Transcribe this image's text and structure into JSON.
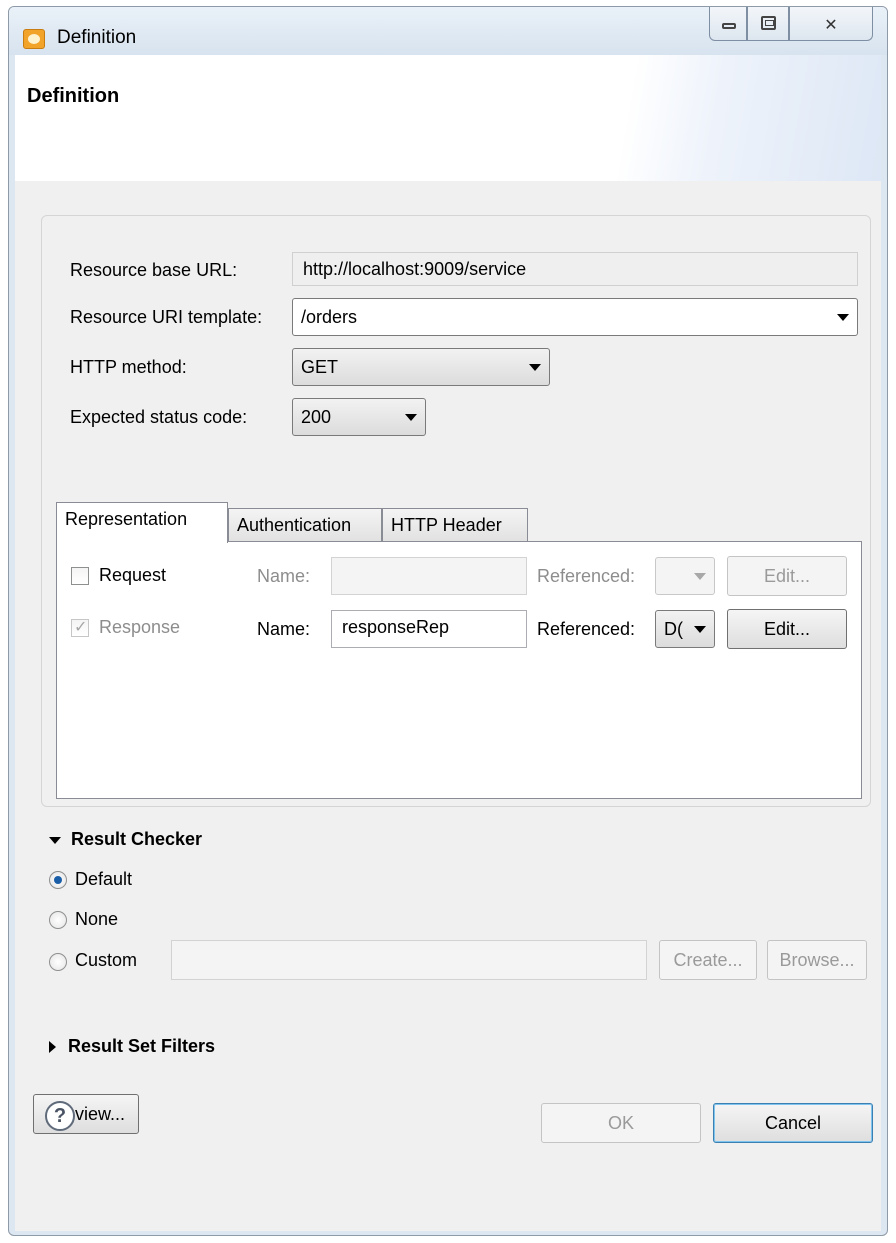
{
  "window": {
    "title": "Definition"
  },
  "banner": {
    "title": "Definition"
  },
  "form": {
    "base_url_label": "Resource base URL:",
    "base_url_value": "http://localhost:9009/service",
    "uri_template_label": "Resource URI template:",
    "uri_template_value": "/orders",
    "http_method_label": "HTTP method:",
    "http_method_value": "GET",
    "status_code_label": "Expected status code:",
    "status_code_value": "200"
  },
  "tabs": [
    {
      "label": "Representation",
      "active": true
    },
    {
      "label": "Authentication",
      "active": false
    },
    {
      "label": "HTTP Header",
      "active": false
    }
  ],
  "representation": {
    "request": {
      "label": "Request",
      "checked": false,
      "name_label": "Name:",
      "name_value": "",
      "referenced_label": "Referenced:",
      "referenced_value": "",
      "edit_label": "Edit..."
    },
    "response": {
      "label": "Response",
      "checked": true,
      "name_label": "Name:",
      "name_value": "responseRep",
      "referenced_label": "Referenced:",
      "referenced_value": "D(",
      "edit_label": "Edit..."
    }
  },
  "result_checker": {
    "title": "Result Checker",
    "options": [
      {
        "label": "Default",
        "selected": true
      },
      {
        "label": "None",
        "selected": false
      },
      {
        "label": "Custom",
        "selected": false
      }
    ],
    "custom_value": "",
    "create_label": "Create...",
    "browse_label": "Browse..."
  },
  "result_set_filters": {
    "title": "Result Set Filters"
  },
  "buttons": {
    "preview": "Preview...",
    "ok": "OK",
    "cancel": "Cancel",
    "help": "?"
  },
  "icons": {
    "app": "app-icon",
    "minimize": "minimize-icon",
    "maximize": "maximize-icon",
    "close": "close-icon",
    "help": "help-icon",
    "expanded": "triangle-down-icon",
    "collapsed": "triangle-right-icon",
    "dropdown": "chevron-down-icon"
  }
}
